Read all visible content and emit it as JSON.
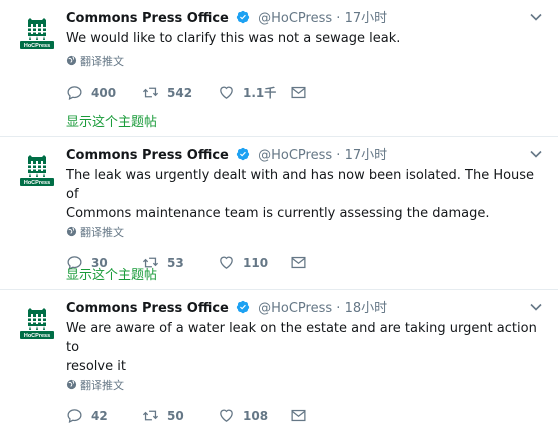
{
  "tweets": [
    {
      "name": "Commons Press Office",
      "handle": "@HoCPress",
      "dot": "·",
      "time": "17小时",
      "text_lines": [
        "We would like to clarify this was not a sewage leak."
      ],
      "translate": "翻译推文",
      "replies": "400",
      "retweets": "542",
      "likes": "1.1千",
      "thread_link": "显示这个主题帖",
      "avatar_label": "HoCPress"
    },
    {
      "name": "Commons Press Office",
      "handle": "@HoCPress",
      "dot": "·",
      "time": "17小时",
      "text_lines": [
        "The leak was urgently dealt with and has now been isolated. The House of",
        "Commons maintenance team is currently assessing the damage."
      ],
      "translate": "翻译推文",
      "replies": "30",
      "retweets": "53",
      "likes": "110",
      "thread_link": "显示这个主题帖",
      "avatar_label": "HoCPress"
    },
    {
      "name": "Commons Press Office",
      "handle": "@HoCPress",
      "dot": "·",
      "time": "18小时",
      "text_lines": [
        "We are aware of a water leak on the estate and are taking urgent action to",
        "resolve it"
      ],
      "translate": "翻译推文",
      "replies": "42",
      "retweets": "50",
      "likes": "108",
      "avatar_label": "HoCPress"
    }
  ],
  "colors": {
    "accent_green": "#1a9b3a",
    "verified_blue": "#1da1f2",
    "muted": "#657786",
    "portcullis_green": "#006e46"
  },
  "icons": [
    "verified-icon",
    "caret-down-icon",
    "globe-icon",
    "reply-icon",
    "retweet-icon",
    "like-icon",
    "message-icon",
    "portcullis-icon"
  ]
}
